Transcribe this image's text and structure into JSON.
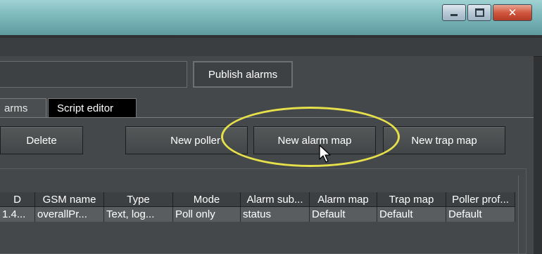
{
  "window": {
    "controls": {
      "minimize": "minimize-icon",
      "maximize": "maximize-icon",
      "close": "close-icon"
    }
  },
  "toolbar": {
    "publish_label": "Publish alarms"
  },
  "tabs": [
    {
      "label": "arms"
    },
    {
      "label": "Script editor"
    }
  ],
  "actions": {
    "delete_label": "Delete",
    "new_poller_label": "New poller",
    "new_alarm_map_label": "New alarm map",
    "new_trap_map_label": "New trap map"
  },
  "table": {
    "columns": [
      "D",
      "GSM name",
      "Type",
      "Mode",
      "Alarm sub...",
      "Alarm map",
      "Trap map",
      "Poller prof..."
    ],
    "rows": [
      [
        "1.4...",
        "overallPr...",
        "Text, log...",
        "Poll only",
        "status",
        "Default",
        "Default",
        "Default"
      ]
    ]
  },
  "colors": {
    "highlight": "#e6e04a",
    "titlebar": "#7db8bb"
  }
}
